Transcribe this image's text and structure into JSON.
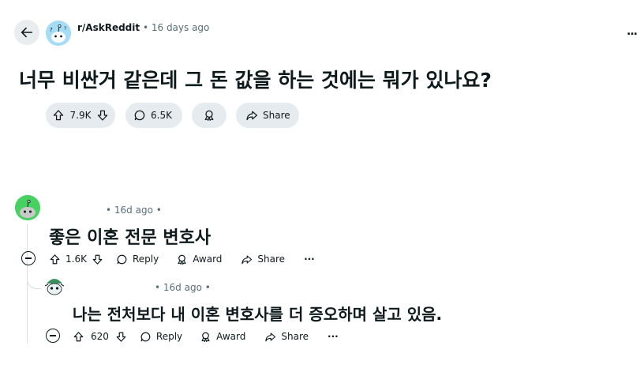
{
  "header": {
    "subreddit": "r/AskReddit",
    "separator": "•",
    "time": "16 days ago",
    "icons": {
      "back": "arrow-left-icon",
      "more": "more-horizontal-icon"
    },
    "more_label": "..."
  },
  "post": {
    "title": "너무 비싼거 같은데 그 돈 값을 하는 것에는 뭐가 있나요?",
    "votes": "7.9K",
    "comments": "6.5K",
    "share_label": "Share"
  },
  "comments": [
    {
      "meta": "• 16d ago •",
      "body": "좋은 이혼 전문 변호사",
      "votes": "1.6K",
      "reply_label": "Reply",
      "award_label": "Award",
      "share_label": "Share",
      "more_label": "···"
    },
    {
      "meta": "• 16d ago •",
      "body": "나는 전처보다 내 이혼 변호사를 더 증오하며 살고 있음.",
      "votes": "620",
      "reply_label": "Reply",
      "award_label": "Award",
      "share_label": "Share",
      "more_label": "···"
    }
  ],
  "colors": {
    "pill_bg": "#e5ebee",
    "meta_text": "#576f76",
    "thread_line": "#d9dfe2"
  }
}
